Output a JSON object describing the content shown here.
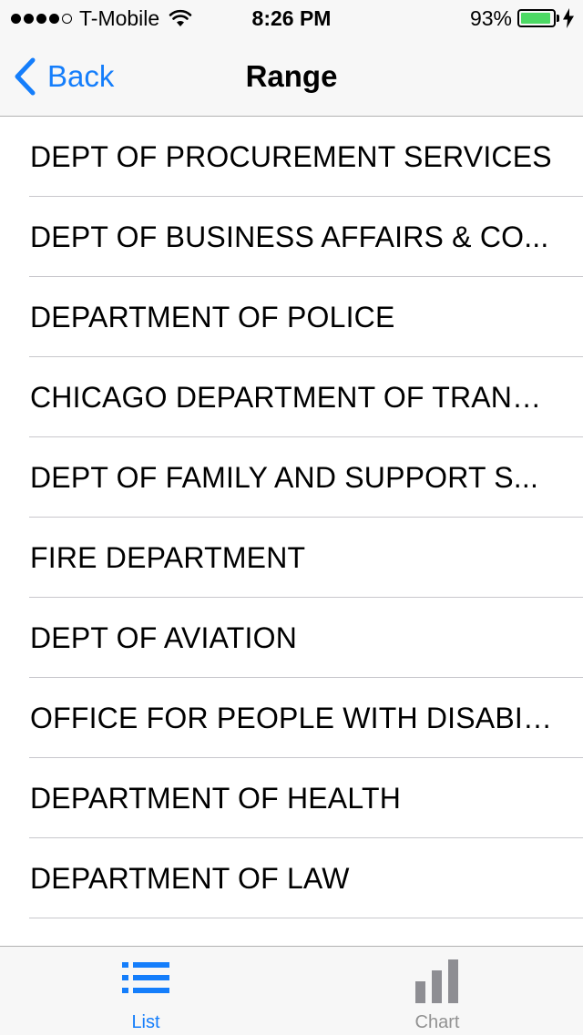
{
  "status_bar": {
    "carrier": "T-Mobile",
    "time": "8:26 PM",
    "battery_percent": "93%",
    "signal_bars_filled": 4,
    "signal_bars_total": 5,
    "battery_level": 0.93,
    "battery_color": "#4cd964"
  },
  "nav": {
    "back_label": "Back",
    "title": "Range",
    "accent_color": "#157efb"
  },
  "list": {
    "items": [
      {
        "label": "DEPT OF PROCUREMENT SERVICES"
      },
      {
        "label": "DEPT OF BUSINESS AFFAIRS & CO..."
      },
      {
        "label": "DEPARTMENT OF POLICE"
      },
      {
        "label": "CHICAGO DEPARTMENT OF TRANS..."
      },
      {
        "label": "DEPT OF FAMILY AND SUPPORT S..."
      },
      {
        "label": "FIRE DEPARTMENT"
      },
      {
        "label": "DEPT OF AVIATION"
      },
      {
        "label": "OFFICE FOR PEOPLE WITH DISABIL..."
      },
      {
        "label": "DEPARTMENT OF HEALTH"
      },
      {
        "label": "DEPARTMENT OF LAW"
      }
    ]
  },
  "tab_bar": {
    "tabs": [
      {
        "label": "List",
        "icon": "list-icon",
        "selected": true
      },
      {
        "label": "Chart",
        "icon": "bar-chart-icon",
        "selected": false
      }
    ],
    "selected_color": "#157efb",
    "unselected_color": "#929292"
  }
}
